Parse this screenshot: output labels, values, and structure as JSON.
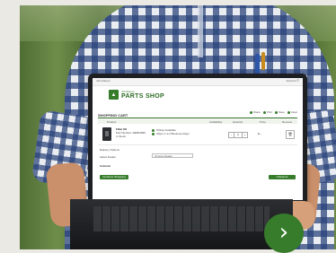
{
  "screen": {
    "topbar_left": "John Deere",
    "topbar_right": "Account  ☰",
    "brand_small": "JohnDeere",
    "brand_big": "PARTS SHOP",
    "section_title": "SHOPPING CART",
    "actions": [
      "Share",
      "Print",
      "Save",
      "Clear"
    ],
    "columns": [
      "Product",
      "Availability",
      "Quantity",
      "Price",
      "Remove"
    ],
    "item": {
      "name": "Filter Oil",
      "line1": "Part Number: RE504836",
      "line2": "In Stock",
      "avail1": "Pickup Available",
      "avail2": "Ships in 1-2 Business Days",
      "qty": "1",
      "price": "$--"
    },
    "ship_label": "Delivery Options",
    "dealer_label": "Select Dealer",
    "select_value": "Choose Dealer",
    "subtotal": "Subtotal",
    "continue_btn": "Continue Shopping",
    "checkout_btn": "Checkout"
  },
  "colors": {
    "brand_green": "#367c2b",
    "next_button": "#367c2b"
  },
  "icons": {
    "next": "chevron-right-icon"
  },
  "next_glyph": "›"
}
